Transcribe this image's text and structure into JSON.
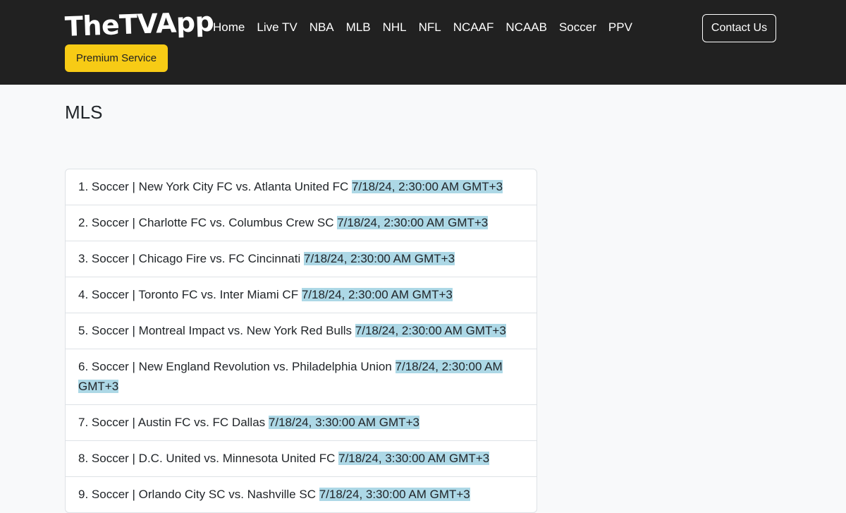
{
  "header": {
    "brand": "TheTVApp",
    "premium_label": "Premium Service",
    "nav": [
      "Home",
      "Live TV",
      "NBA",
      "MLB",
      "NHL",
      "NFL",
      "NCAAF",
      "NCAAB",
      "Soccer",
      "PPV"
    ],
    "contact_label": "Contact Us"
  },
  "main": {
    "title": "MLS",
    "events": [
      {
        "label": "1. Soccer | New York City FC vs. Atlanta United FC",
        "time": "7/18/24, 2:30:00 AM GMT+3"
      },
      {
        "label": "2. Soccer | Charlotte FC vs. Columbus Crew SC",
        "time": "7/18/24, 2:30:00 AM GMT+3"
      },
      {
        "label": "3. Soccer | Chicago Fire vs. FC Cincinnati",
        "time": "7/18/24, 2:30:00 AM GMT+3"
      },
      {
        "label": "4. Soccer | Toronto FC vs. Inter Miami CF",
        "time": "7/18/24, 2:30:00 AM GMT+3"
      },
      {
        "label": "5. Soccer | Montreal Impact vs. New York Red Bulls",
        "time": "7/18/24, 2:30:00 AM GMT+3"
      },
      {
        "label": "6. Soccer | New England Revolution vs. Philadelphia Union",
        "time": "7/18/24, 2:30:00 AM GMT+3"
      },
      {
        "label": "7. Soccer | Austin FC vs. FC Dallas",
        "time": "7/18/24, 3:30:00 AM GMT+3"
      },
      {
        "label": "8. Soccer | D.C. United vs. Minnesota United FC",
        "time": "7/18/24, 3:30:00 AM GMT+3"
      },
      {
        "label": "9. Soccer | Orlando City SC vs. Nashville SC",
        "time": "7/18/24, 3:30:00 AM GMT+3"
      }
    ]
  },
  "colors": {
    "navbar": "#212121",
    "premium": "#f7cb15",
    "time_highlight": "#add8e6"
  }
}
